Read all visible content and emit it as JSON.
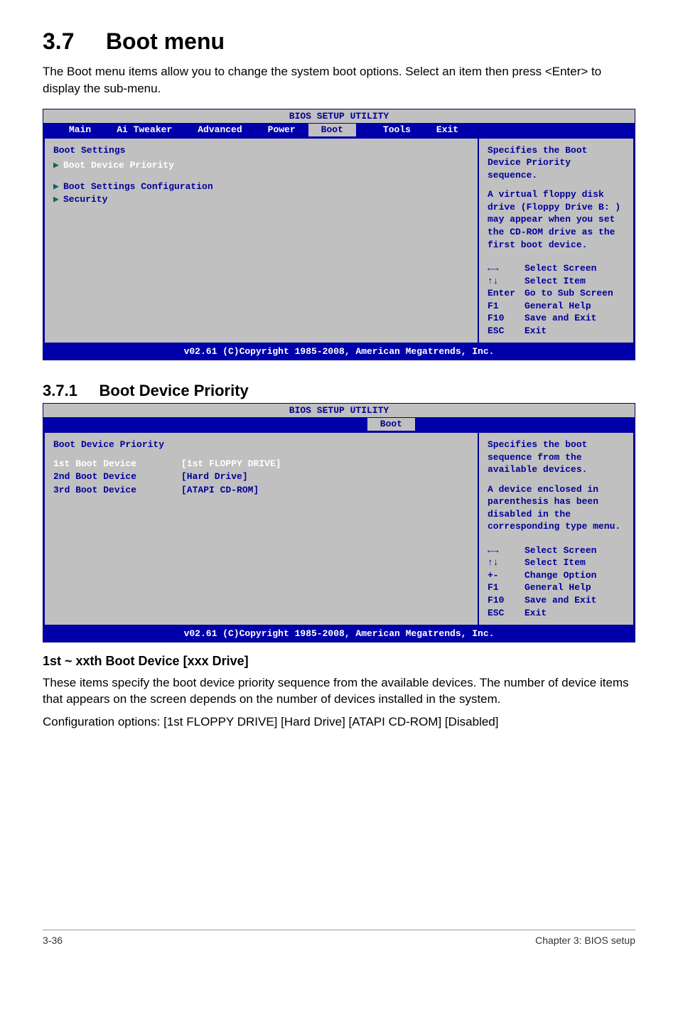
{
  "section": {
    "number": "3.7",
    "title": "Boot menu",
    "description": "The Boot menu items allow you to change the system boot options. Select an item then press <Enter> to display the sub-menu."
  },
  "bios1": {
    "title": "BIOS SETUP UTILITY",
    "tabs": [
      "Main",
      "Ai Tweaker",
      "Advanced",
      "Power",
      "Boot",
      "Tools",
      "Exit"
    ],
    "active_tab": "Boot",
    "heading": "Boot Settings",
    "items": [
      {
        "label": "Boot Device Priority",
        "selected": true
      },
      {
        "label": "Boot Settings Configuration",
        "selected": false
      },
      {
        "label": "Security",
        "selected": false
      }
    ],
    "help_top": "Specifies the Boot Device Priority sequence.",
    "help_mid": "A virtual floppy disk drive (Floppy Drive B: ) may appear when you set the CD-ROM drive as the first boot device.",
    "nav": [
      {
        "k": "←→",
        "v": "Select Screen"
      },
      {
        "k": "↑↓",
        "v": "Select Item"
      },
      {
        "k": "Enter",
        "v": "Go to Sub Screen"
      },
      {
        "k": "F1",
        "v": "General Help"
      },
      {
        "k": "F10",
        "v": "Save and Exit"
      },
      {
        "k": "ESC",
        "v": "Exit"
      }
    ],
    "footer": "v02.61 (C)Copyright 1985-2008, American Megatrends, Inc."
  },
  "subsection": {
    "number": "3.7.1",
    "title": "Boot Device Priority"
  },
  "bios2": {
    "title": "BIOS SETUP UTILITY",
    "active_tab": "Boot",
    "heading": "Boot Device Priority",
    "items": [
      {
        "label": "1st Boot Device",
        "value": "[1st FLOPPY DRIVE]",
        "selected": true
      },
      {
        "label": "2nd Boot Device",
        "value": "[Hard Drive]",
        "selected": false
      },
      {
        "label": "3rd Boot Device",
        "value": "[ATAPI CD-ROM]",
        "selected": false
      }
    ],
    "help_top": "Specifies the boot sequence from the available devices.",
    "help_mid": "A device enclosed in parenthesis has been disabled in the corresponding type menu.",
    "nav": [
      {
        "k": "←→",
        "v": "Select Screen"
      },
      {
        "k": "↑↓",
        "v": "Select Item"
      },
      {
        "k": "+-",
        "v": "Change Option"
      },
      {
        "k": "F1",
        "v": "General Help"
      },
      {
        "k": "F10",
        "v": "Save and Exit"
      },
      {
        "k": "ESC",
        "v": "Exit"
      }
    ],
    "footer": "v02.61 (C)Copyright 1985-2008, American Megatrends, Inc."
  },
  "option": {
    "heading": "1st ~ xxth Boot Device [xxx Drive]",
    "desc1": "These items specify the boot device priority sequence from the available devices. The number of device items that appears on the screen depends on the number of devices installed in the system.",
    "desc2": "Configuration options: [1st FLOPPY DRIVE] [Hard Drive] [ATAPI CD-ROM] [Disabled]"
  },
  "footer": {
    "left": "3-36",
    "right": "Chapter 3: BIOS setup"
  }
}
